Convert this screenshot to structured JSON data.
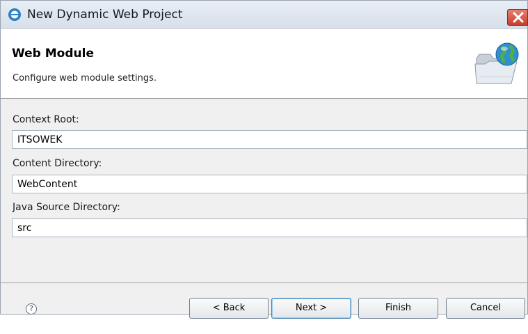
{
  "window": {
    "title": "New Dynamic Web Project"
  },
  "banner": {
    "title": "Web Module",
    "description": "Configure web module settings."
  },
  "form": {
    "context_root_label": "Context Root:",
    "context_root_value": "ITSOWEK",
    "content_dir_label": "Content Directory:",
    "content_dir_value": "WebContent",
    "java_src_label": "Java Source Directory:",
    "java_src_value": "src"
  },
  "footer": {
    "help_glyph": "?",
    "back_label": "< Back",
    "next_label": "Next >",
    "finish_label": "Finish",
    "cancel_label": "Cancel"
  },
  "icons": {
    "app": "eclipse-icon",
    "close": "close-icon",
    "banner": "web-module-folder-globe-icon",
    "help": "help-icon"
  },
  "colors": {
    "close_button": "#c7402c",
    "banner_bg": "#ffffff",
    "default_button_border": "#3c7fb1"
  }
}
